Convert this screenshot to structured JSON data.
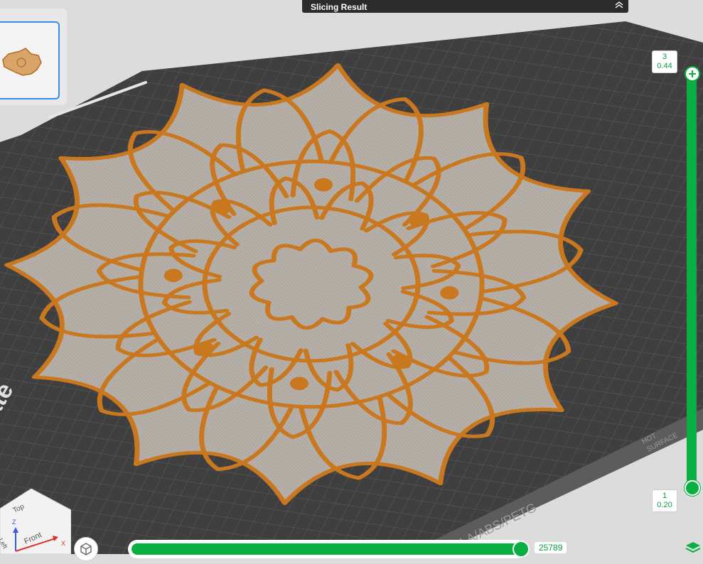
{
  "slicing_panel": {
    "title": "Slicing Result"
  },
  "thumbnail": {
    "selected": true
  },
  "layer_slider": {
    "top": {
      "layer": "3",
      "height": "0.44"
    },
    "bottom": {
      "layer": "1",
      "height": "0.20"
    }
  },
  "move_slider": {
    "value": "25789",
    "progress": 0.98
  },
  "view_cube": {
    "top_label": "Top",
    "front_label": "Front",
    "left_label": "Left",
    "z_axis": "Z",
    "x_axis": "X"
  },
  "plate_text": {
    "materials": "PLA/ABS/PETG",
    "warning_line1": "HOT",
    "warning_line2": "SURFACE",
    "brand_fragment": "ate"
  },
  "colors": {
    "accent": "#0aaf42",
    "filament": "#c9781f",
    "fill": "#b4aea6",
    "bed": "#404040",
    "background": "#dcdcdc"
  },
  "icons": [
    "collapse-icon",
    "cube-view-icon",
    "layers-icon",
    "axis-gizmo-icon"
  ]
}
